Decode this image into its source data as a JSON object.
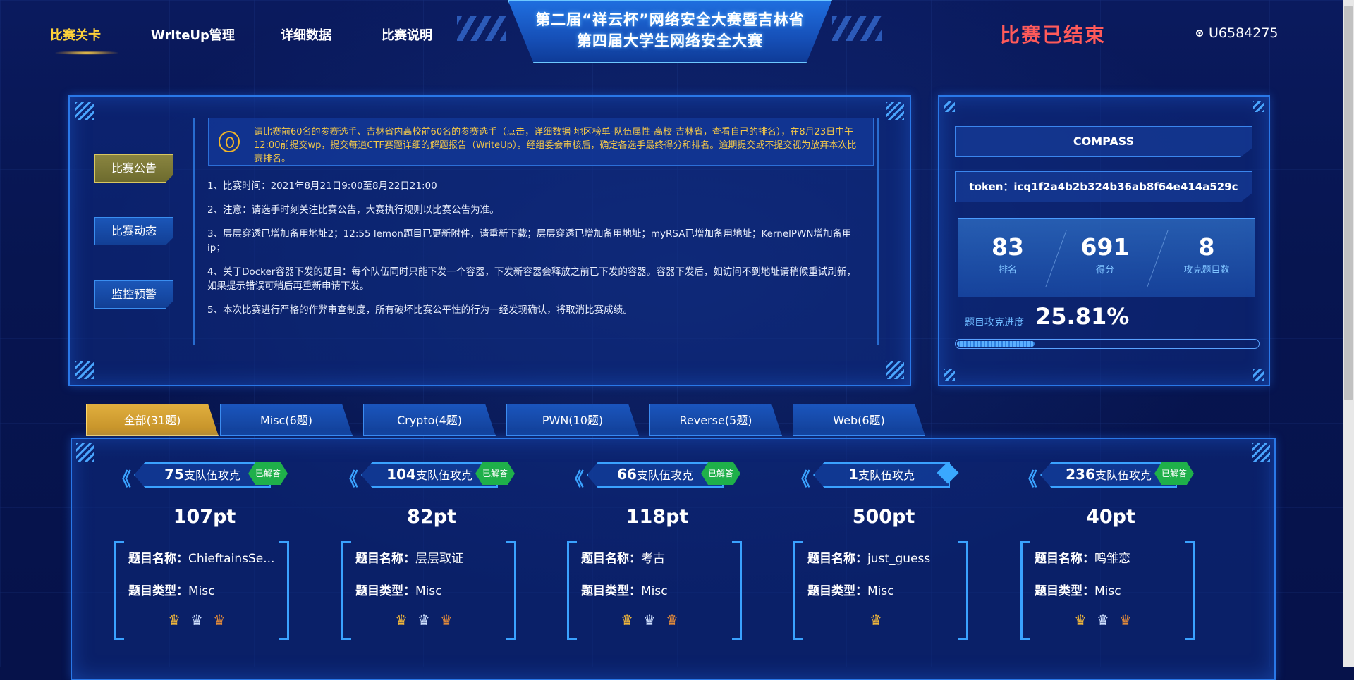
{
  "nav": {
    "items": [
      "比赛关卡",
      "WriteUp管理",
      "详细数据",
      "比赛说明"
    ],
    "title_line1": "第二届“祥云杯”网络安全大赛暨吉林省",
    "title_line2": "第四届大学生网络安全大赛",
    "status": "比赛已结束",
    "user": "U6584275"
  },
  "side_menu": [
    "比赛公告",
    "比赛动态",
    "监控预警"
  ],
  "notice": {
    "highlight": "请比赛前60名的参赛选手、吉林省内高校前60名的参赛选手（点击，详细数据-地区榜单-队伍属性-高校-吉林省，查看自己的排名），在8月23日中午12:00前提交wp，提交每道CTF赛题详细的解题报告（WriteUp）。经组委会审核后，确定各选手最终得分和排名。逾期提交或不提交视为放弃本次比赛排名。",
    "rules": [
      "1、比赛时间：2021年8月21日9:00至8月22日21:00",
      "2、注意：请选手时刻关注比赛公告，大赛执行规则以比赛公告为准。",
      "3、层层穿透已增加备用地址2；12:55 lemon题目已更新附件，请重新下载；层层穿透已增加备用地址；myRSA已增加备用地址；KernelPWN增加备用ip；",
      "4、关于Docker容器下发的题目：每个队伍同时只能下发一个容器，下发新容器会释放之前已下发的容器。容器下发后，如访问不到地址请稍候重试刷新，如果提示错误可稍后再重新申请下发。",
      "5、本次比赛进行严格的作弊审查制度，所有破坏比赛公平性的行为一经发现确认，将取消比赛成绩。"
    ]
  },
  "team": {
    "name": "COMPASS",
    "token": "token：icq1f2a4b2b324b36ab8f64e414a529c",
    "stats": [
      {
        "value": "83",
        "label": "排名"
      },
      {
        "value": "691",
        "label": "得分"
      },
      {
        "value": "8",
        "label": "攻克题目数"
      }
    ],
    "progress_label": "题目攻克进度",
    "progress_text": "25.81%",
    "progress": 0.2581
  },
  "tabs": [
    "全部(31题)",
    "Misc(6题)",
    "Crypto(4题)",
    "PWN(10题)",
    "Reverse(5题)",
    "Web(6题)"
  ],
  "cards": [
    {
      "teams": "75",
      "suffix": "支队伍攻克",
      "badge": "已解答",
      "points": "107pt",
      "name_key": "题目名称：",
      "name": "ChieftainsSe...",
      "type_key": "题目类型：",
      "type": "Misc",
      "crowns": 3
    },
    {
      "teams": "104",
      "suffix": "支队伍攻克",
      "badge": "已解答",
      "points": "82pt",
      "name_key": "题目名称：",
      "name": "层层取证",
      "type_key": "题目类型：",
      "type": "Misc",
      "crowns": 3
    },
    {
      "teams": "66",
      "suffix": "支队伍攻克",
      "badge": "已解答",
      "points": "118pt",
      "name_key": "题目名称：",
      "name": "考古",
      "type_key": "题目类型：",
      "type": "Misc",
      "crowns": 3
    },
    {
      "teams": "1",
      "suffix": "支队伍攻克",
      "badge": "",
      "points": "500pt",
      "name_key": "题目名称：",
      "name": "just_guess",
      "type_key": "题目类型：",
      "type": "Misc",
      "crowns": 1
    },
    {
      "teams": "236",
      "suffix": "支队伍攻克",
      "badge": "已解答",
      "points": "40pt",
      "name_key": "题目名称：",
      "name": "鸣雏恋",
      "type_key": "题目类型：",
      "type": "Misc",
      "crowns": 3
    }
  ],
  "colors": {
    "accent": "#ffd23a",
    "ended": "#ff5a5a",
    "solved": "#1fb04a",
    "border": "#2a78e8"
  }
}
